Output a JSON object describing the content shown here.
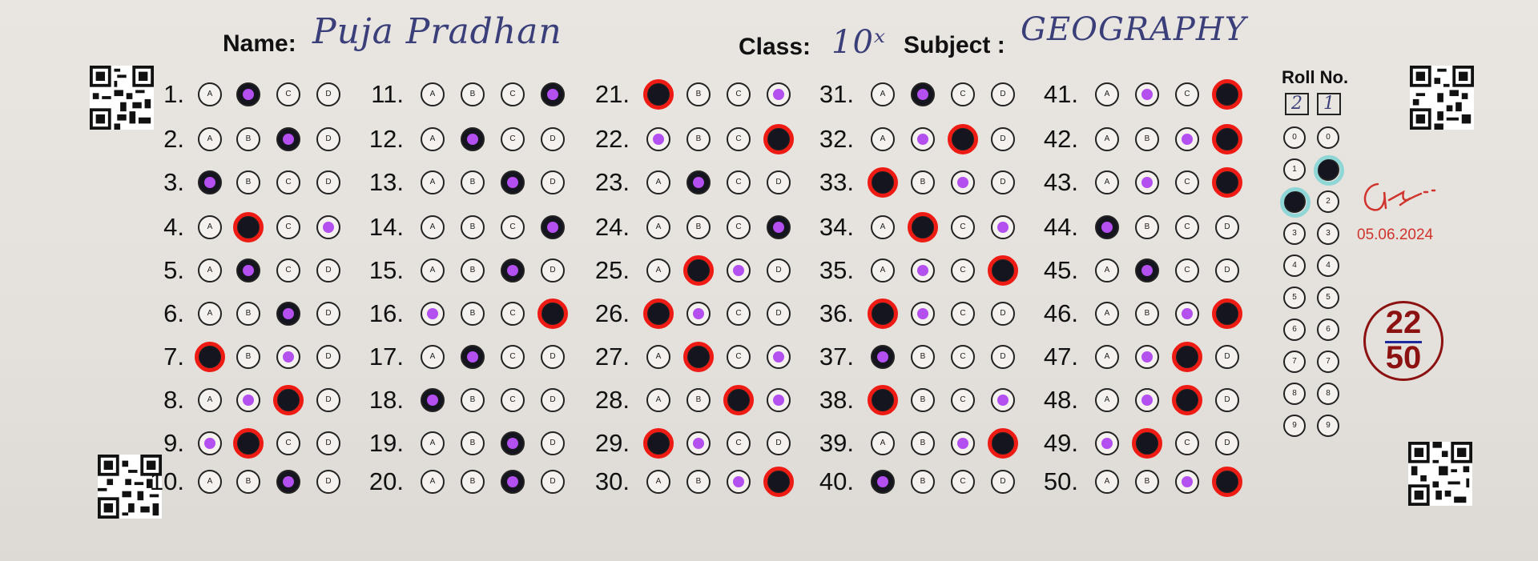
{
  "header": {
    "name_label": "Name:",
    "name_value": "Puja Pradhan",
    "class_label": "Class:",
    "class_value": "10ˣ",
    "subject_label": "Subject :",
    "subject_value": "GEOGRAPHY"
  },
  "roll": {
    "title": "Roll No.",
    "digits": [
      "2",
      "1"
    ]
  },
  "signature_date": "05.06.2024",
  "score": {
    "numerator": "22",
    "denominator": "50"
  },
  "colors": {
    "correct": "#1ee010",
    "wrong": "#ee1b14",
    "key_dot": "#b44ff0",
    "fill": "#15151f",
    "score": "#8c1212"
  },
  "answers": [
    {
      "q": "1.",
      "marked": "B",
      "key": "B"
    },
    {
      "q": "2.",
      "marked": "C",
      "key": "C"
    },
    {
      "q": "3.",
      "marked": "A",
      "key": "A"
    },
    {
      "q": "4.",
      "marked": "B",
      "key": "D"
    },
    {
      "q": "5.",
      "marked": "B",
      "key": "B"
    },
    {
      "q": "6.",
      "marked": "C",
      "key": "C"
    },
    {
      "q": "7.",
      "marked": "A",
      "key": "C"
    },
    {
      "q": "8.",
      "marked": "C",
      "key": "B"
    },
    {
      "q": "9.",
      "marked": "B",
      "key": "A"
    },
    {
      "q": "10.",
      "marked": "C",
      "key": "C"
    },
    {
      "q": "11.",
      "marked": "D",
      "key": "D"
    },
    {
      "q": "12.",
      "marked": "B",
      "key": "B"
    },
    {
      "q": "13.",
      "marked": "C",
      "key": "C"
    },
    {
      "q": "14.",
      "marked": "D",
      "key": "D"
    },
    {
      "q": "15.",
      "marked": "C",
      "key": "C"
    },
    {
      "q": "16.",
      "marked": "D",
      "key": "A"
    },
    {
      "q": "17.",
      "marked": "B",
      "key": "B"
    },
    {
      "q": "18.",
      "marked": "A",
      "key": "A"
    },
    {
      "q": "19.",
      "marked": "C",
      "key": "C"
    },
    {
      "q": "20.",
      "marked": "C",
      "key": "C"
    },
    {
      "q": "21.",
      "marked": "A",
      "key": "D"
    },
    {
      "q": "22.",
      "marked": "D",
      "key": "A"
    },
    {
      "q": "23.",
      "marked": "B",
      "key": "B"
    },
    {
      "q": "24.",
      "marked": "D",
      "key": "D"
    },
    {
      "q": "25.",
      "marked": "B",
      "key": "C"
    },
    {
      "q": "26.",
      "marked": "A",
      "key": "B"
    },
    {
      "q": "27.",
      "marked": "B",
      "key": "D"
    },
    {
      "q": "28.",
      "marked": "C",
      "key": "D"
    },
    {
      "q": "29.",
      "marked": "A",
      "key": "B"
    },
    {
      "q": "30.",
      "marked": "D",
      "key": "C"
    },
    {
      "q": "31.",
      "marked": "B",
      "key": "B"
    },
    {
      "q": "32.",
      "marked": "C",
      "key": "B"
    },
    {
      "q": "33.",
      "marked": "A",
      "key": "C"
    },
    {
      "q": "34.",
      "marked": "B",
      "key": "D"
    },
    {
      "q": "35.",
      "marked": "D",
      "key": "B"
    },
    {
      "q": "36.",
      "marked": "A",
      "key": "B"
    },
    {
      "q": "37.",
      "marked": "A",
      "key": "A"
    },
    {
      "q": "38.",
      "marked": "A",
      "key": "D"
    },
    {
      "q": "39.",
      "marked": "D",
      "key": "C"
    },
    {
      "q": "40.",
      "marked": "A",
      "key": "A"
    },
    {
      "q": "41.",
      "marked": "D",
      "key": "B"
    },
    {
      "q": "42.",
      "marked": "D",
      "key": "C"
    },
    {
      "q": "43.",
      "marked": "D",
      "key": "B"
    },
    {
      "q": "44.",
      "marked": "A",
      "key": "A"
    },
    {
      "q": "45.",
      "marked": "B",
      "key": "B"
    },
    {
      "q": "46.",
      "marked": "D",
      "key": "C"
    },
    {
      "q": "47.",
      "marked": "C",
      "key": "B"
    },
    {
      "q": "48.",
      "marked": "C",
      "key": "B"
    },
    {
      "q": "49.",
      "marked": "B",
      "key": "A"
    },
    {
      "q": "50.",
      "marked": "D",
      "key": "C"
    }
  ],
  "option_letters": [
    "A",
    "B",
    "C",
    "D"
  ],
  "roll_digit_labels": [
    "0",
    "1",
    "2",
    "3",
    "4",
    "5",
    "6",
    "7",
    "8",
    "9"
  ]
}
